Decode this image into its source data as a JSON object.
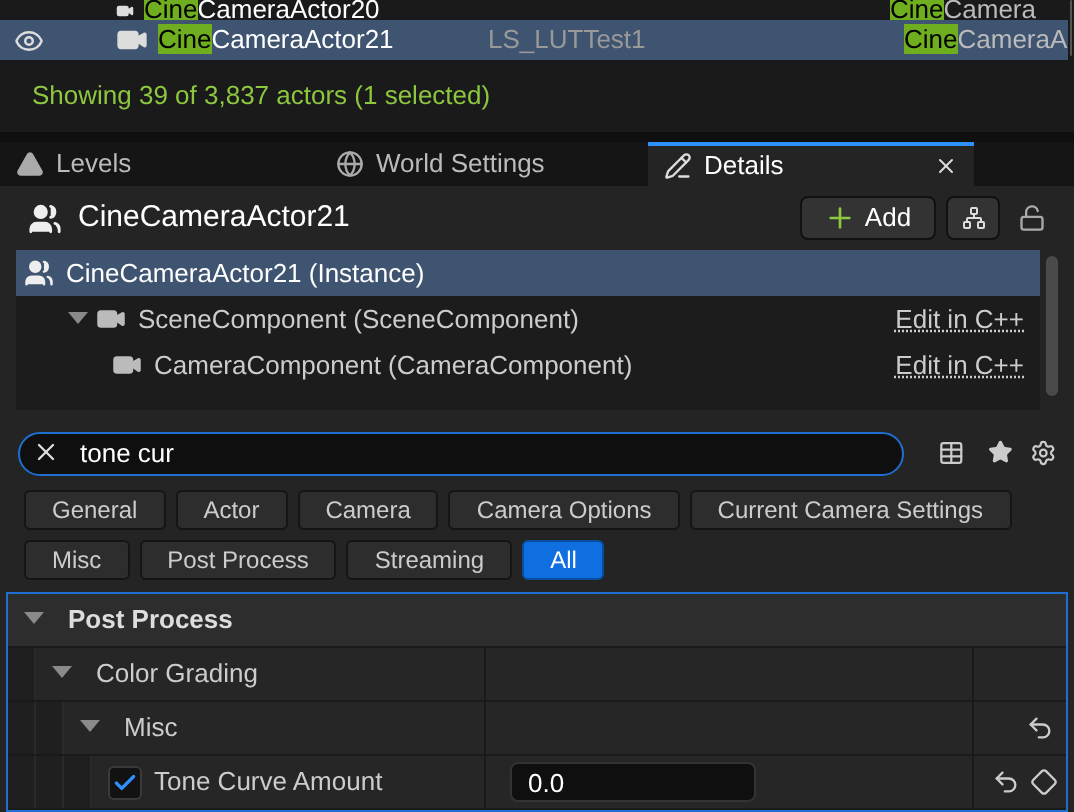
{
  "outliner": {
    "rows": [
      {
        "match": "Cine",
        "rest": "CameraActor20",
        "level": "",
        "type_match": "Cine",
        "type_rest": "Camera",
        "selected": false
      },
      {
        "match": "Cine",
        "rest": "CameraActor21",
        "level": "LS_LUTTest1",
        "type_match": "Cine",
        "type_rest": "CameraA",
        "selected": true,
        "visible": true
      }
    ],
    "status": "Showing 39 of 3,837 actors (1 selected)"
  },
  "tabs": [
    {
      "label": "Levels",
      "selected": false
    },
    {
      "label": "World Settings",
      "selected": false
    },
    {
      "label": "Details",
      "selected": true
    }
  ],
  "details": {
    "title": "CineCameraActor21",
    "add_button": "Add",
    "components": [
      {
        "label": "CineCameraActor21 (Instance)",
        "selected": true,
        "children": [
          {
            "label": "SceneComponent (SceneComponent)",
            "selected": false,
            "link": "Edit in C++",
            "expanded": true,
            "children": [
              {
                "label": "CameraComponent (CameraComponent)",
                "selected": false,
                "link": "Edit in C++"
              }
            ]
          }
        ]
      }
    ],
    "search": {
      "value": "tone cur"
    },
    "filters": [
      [
        {
          "label": "General",
          "selected": false
        },
        {
          "label": "Actor",
          "selected": false
        },
        {
          "label": "Camera",
          "selected": false
        },
        {
          "label": "Camera Options",
          "selected": false
        },
        {
          "label": "Current Camera Settings",
          "selected": false
        }
      ],
      [
        {
          "label": "Misc",
          "selected": false
        },
        {
          "label": "Post Process",
          "selected": false
        },
        {
          "label": "Streaming",
          "selected": false
        },
        {
          "label": "All",
          "selected": true
        }
      ]
    ],
    "properties": [
      {
        "kind": "category",
        "label": "Post Process",
        "expanded": true,
        "children": [
          {
            "kind": "group",
            "label": "Color Grading",
            "expanded": true,
            "children": [
              {
                "kind": "group",
                "label": "Misc",
                "expanded": true,
                "children": [
                  {
                    "kind": "property",
                    "label": "Tone Curve Amount",
                    "checked": true,
                    "value": "0.0"
                  }
                ]
              }
            ]
          }
        ]
      }
    ]
  }
}
